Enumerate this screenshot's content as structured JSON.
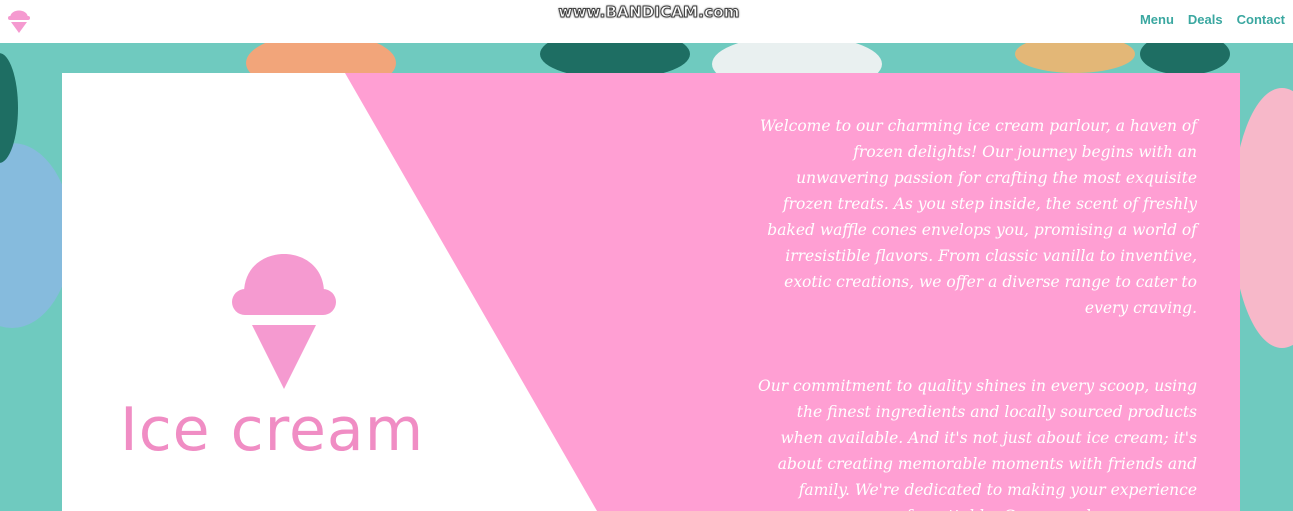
{
  "watermark": "www.BANDICAM.com",
  "nav": {
    "logo_icon": "ice-cream-icon",
    "links": [
      "Menu",
      "Deals",
      "Contact"
    ]
  },
  "hero": {
    "title": "Ice cream",
    "icon": "ice-cream-icon",
    "paragraphs": [
      "Welcome to our charming ice cream parlour, a haven of frozen delights! Our journey begins with an unwavering passion for crafting the most exquisite frozen treats. As you step inside, the scent of freshly baked waffle cones envelops you, promising a world of irresistible flavors. From classic vanilla to inventive, exotic creations, we offer a diverse range to cater to every craving.",
      "Our commitment to quality shines in every scoop, using the finest ingredients and locally sourced products when available. And it's not just about ice cream; it's about creating memorable moments with friends and family. We're dedicated to making your experience unforgettable. Come, explore our menu"
    ]
  },
  "colors": {
    "brand_pink": "#ff9fd3",
    "title_pink": "#f08dc4",
    "nav_teal": "#3aa7a0",
    "background_teal": "#6fcabf"
  }
}
